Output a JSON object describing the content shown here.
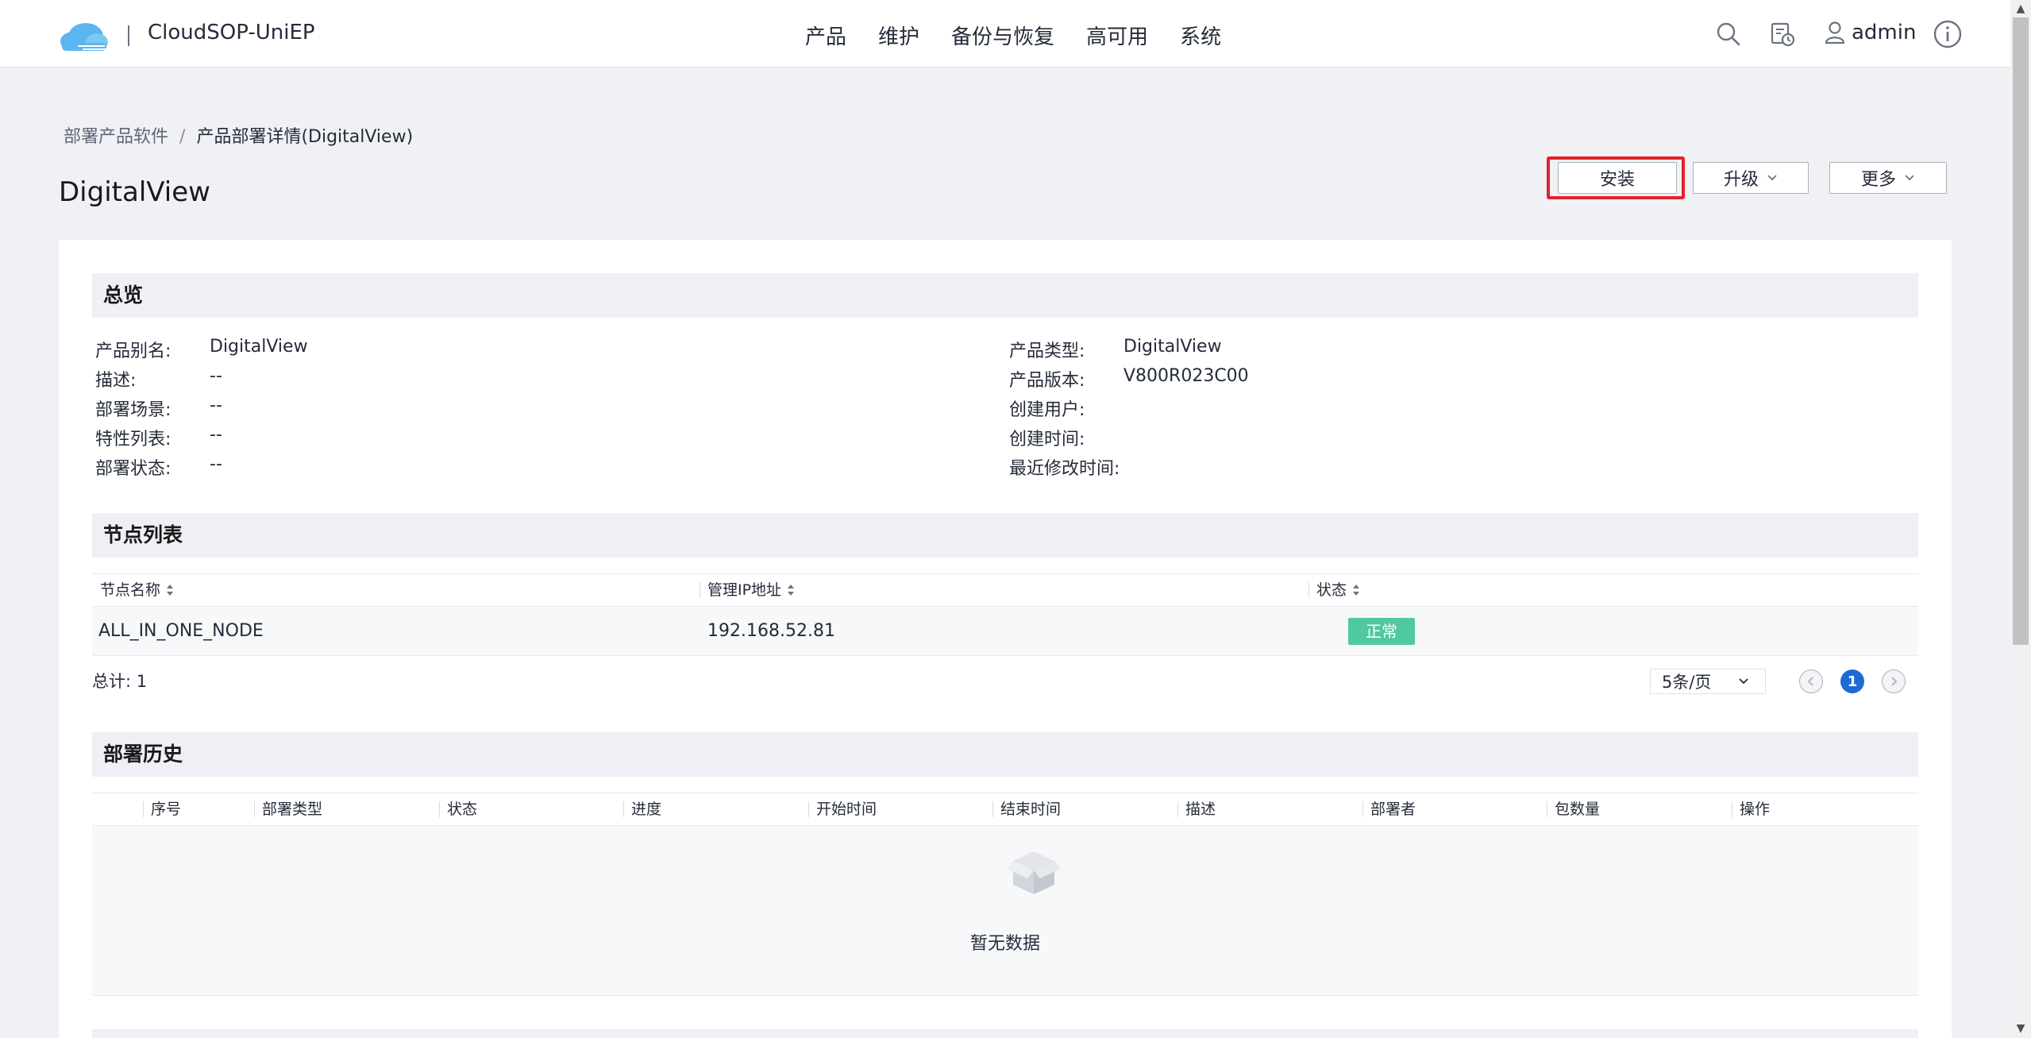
{
  "app": {
    "brand": "CloudSOP-UniEP",
    "nav": [
      "产品",
      "维护",
      "备份与恢复",
      "高可用",
      "系统"
    ],
    "user": "admin",
    "icons": [
      "cloud-logo-icon",
      "search-icon",
      "task-monitor-icon",
      "user-icon",
      "info-icon"
    ]
  },
  "breadcrumb": {
    "parent": "部署产品软件",
    "separator": "/",
    "current": "产品部署详情(DigitalView)"
  },
  "page": {
    "title": "DigitalView"
  },
  "actions": {
    "install": "安装",
    "upgrade": "升级",
    "more": "更多"
  },
  "overview": {
    "heading": "总览",
    "left": [
      {
        "label": "产品别名:",
        "value": "DigitalView"
      },
      {
        "label": "描述:",
        "value": "--"
      },
      {
        "label": "部署场景:",
        "value": "--"
      },
      {
        "label": "特性列表:",
        "value": "--"
      },
      {
        "label": "部署状态:",
        "value": "--"
      }
    ],
    "right": [
      {
        "label": "产品类型:",
        "value": "DigitalView"
      },
      {
        "label": "产品版本:",
        "value": "V800R023C00"
      },
      {
        "label": "创建用户:",
        "value": ""
      },
      {
        "label": "创建时间:",
        "value": ""
      },
      {
        "label": "最近修改时间:",
        "value": ""
      }
    ]
  },
  "nodes": {
    "heading": "节点列表",
    "columns": [
      "节点名称",
      "管理IP地址",
      "状态"
    ],
    "rows": [
      {
        "name": "ALL_IN_ONE_NODE",
        "ip": "192.168.52.81",
        "status": "正常"
      }
    ],
    "total": "总计: 1",
    "page_size": "5条/页",
    "current_page": "1"
  },
  "history": {
    "heading": "部署历史",
    "columns": [
      "序号",
      "部署类型",
      "状态",
      "进度",
      "开始时间",
      "结束时间",
      "描述",
      "部署者",
      "包数量",
      "操作"
    ],
    "empty_text": "暂无数据"
  },
  "colors": {
    "highlight": "#e5202d",
    "status_ok": "#50c8a0",
    "accent": "#1f6bd6"
  }
}
